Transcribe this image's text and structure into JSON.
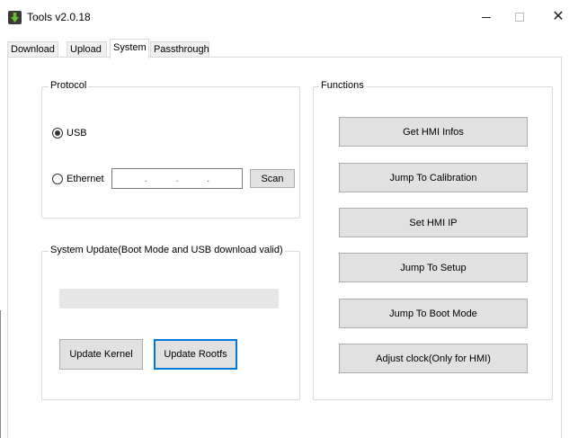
{
  "window": {
    "title": "Tools v2.0.18",
    "minimize_glyph": "—",
    "close_glyph": "✕"
  },
  "tabs": [
    {
      "label": "Download",
      "active": false
    },
    {
      "label": "Upload",
      "active": false
    },
    {
      "label": "System",
      "active": true
    },
    {
      "label": "Passthrough",
      "active": false
    }
  ],
  "protocol": {
    "legend": "Protocol",
    "usb_label": "USB",
    "usb_selected": true,
    "ethernet_label": "Ethernet",
    "ethernet_selected": false,
    "ip_separator": ".",
    "scan_label": "Scan"
  },
  "system_update": {
    "legend": "System Update(Boot Mode and USB download valid)",
    "progress": 0,
    "update_kernel_label": "Update Kernel",
    "update_rootfs_label": "Update Rootfs"
  },
  "functions": {
    "legend": "Functions",
    "buttons": [
      "Get HMI Infos",
      "Jump To Calibration",
      "Set HMI IP",
      "Jump To Setup",
      "Jump To Boot Mode",
      "Adjust clock(Only for HMI)"
    ]
  },
  "colors": {
    "focus_border": "#0078d7",
    "button_face": "#e1e1e1",
    "progress_track": "#e6e6e6"
  }
}
